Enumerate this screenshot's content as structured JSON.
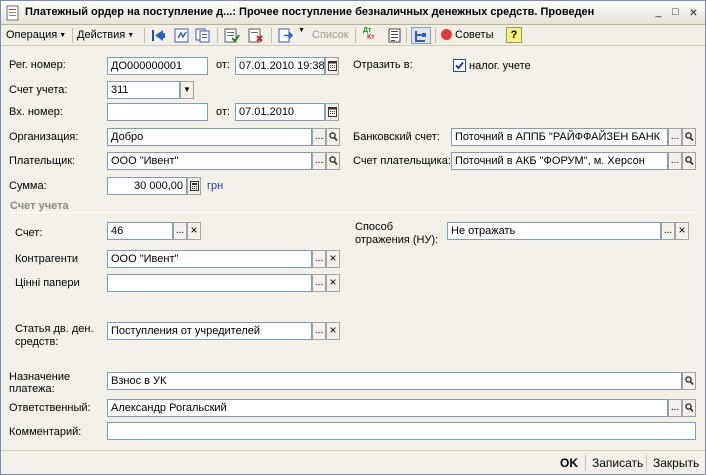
{
  "window": {
    "title": "Платежный ордер на поступление д...: Прочее поступление безналичных денежных средств. Проведен",
    "minimize": "_",
    "maximize": "□",
    "close": "×"
  },
  "toolbar": {
    "operation": "Операция",
    "actions": "Действия",
    "list": "Список",
    "tips": "Советы",
    "help": "?",
    "dtkt_top": "Дт",
    "dtkt_bottom": "Кт"
  },
  "form": {
    "reg_number_label": "Рег. номер:",
    "reg_number": "ДО000000001",
    "from_label": "от:",
    "reg_date": "07.01.2010 19:38:22",
    "reflect_label": "Отразить в:",
    "tax_label": "налог. учете",
    "tax_checked": true,
    "account_label": "Счет учета:",
    "account": "311",
    "in_number_label": "Вх. номер:",
    "in_number": "",
    "in_from_label": "от:",
    "in_date": "07.01.2010",
    "org_label": "Организация:",
    "org": "Добро",
    "bank_account_label": "Банковский счет:",
    "bank_account": "Поточний в АППБ \"РАЙФФАЙЗЕН БАНК",
    "payer_label": "Плательщик:",
    "payer": "ООО \"Ивент\"",
    "payer_account_label": "Счет плательщика:",
    "payer_account": "Поточний в АКБ \"ФОРУМ\", м. Херсон",
    "sum_label": "Сумма:",
    "sum": "30 000,00",
    "currency": "грн"
  },
  "account_section": {
    "title": "Счет учета",
    "account_label": "Счет:",
    "account": "46",
    "contractors_label": "Контрагенти",
    "contractors": "ООО \"Ивент\"",
    "securities_label": "Цінні папери",
    "securities": "",
    "method_label_1": "Способ",
    "method_label_2": "отражения (НУ):",
    "method": "Не отражать",
    "cashflow_label_1": "Статья дв. ден.",
    "cashflow_label_2": "средств:",
    "cashflow": "Поступления от учредителей"
  },
  "bottom": {
    "purpose_label_1": "Назначение",
    "purpose_label_2": "платежа:",
    "purpose": "Взнос в УК",
    "responsible_label": "Ответственный:",
    "responsible": "Александр Рогальский",
    "comment_label": "Комментарий:",
    "comment": "",
    "ok": "OK",
    "save": "Записать",
    "close": "Закрыть"
  },
  "glyphs": {
    "ellipsis": "...",
    "clear": "×",
    "dropdown": "▼",
    "menu_caret": "▼"
  },
  "colors": {
    "window_bg": "#f3f1e7",
    "field_border": "#7f9db9",
    "currency": "#1f3fa0",
    "section_title": "#8a8a80"
  }
}
